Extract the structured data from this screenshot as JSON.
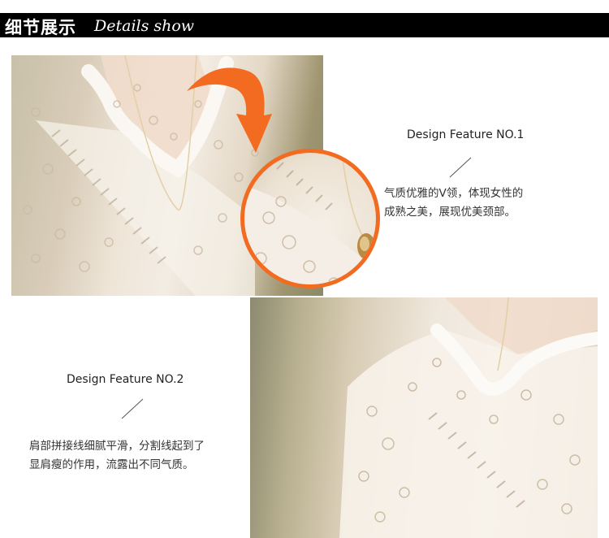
{
  "header": {
    "title_cn": "细节展示",
    "title_en": "Details show",
    "deco_icon": "corner-triangle-icon"
  },
  "features": [
    {
      "title": "Design Feature NO.1",
      "lines": [
        "气质优雅的V领，体现女性的",
        "成熟之美，展现优美颈部。"
      ]
    },
    {
      "title": "Design Feature NO.2",
      "lines": [
        "肩部拼接线细腻平滑，分割线起到了",
        "显肩瘦的作用，流露出不同气质。"
      ]
    }
  ],
  "colors": {
    "header_bg": "#000000",
    "accent": "#f26b21"
  },
  "icons": {
    "arrow": "curved-arrow-icon",
    "zoom": "zoom-circle-icon"
  }
}
